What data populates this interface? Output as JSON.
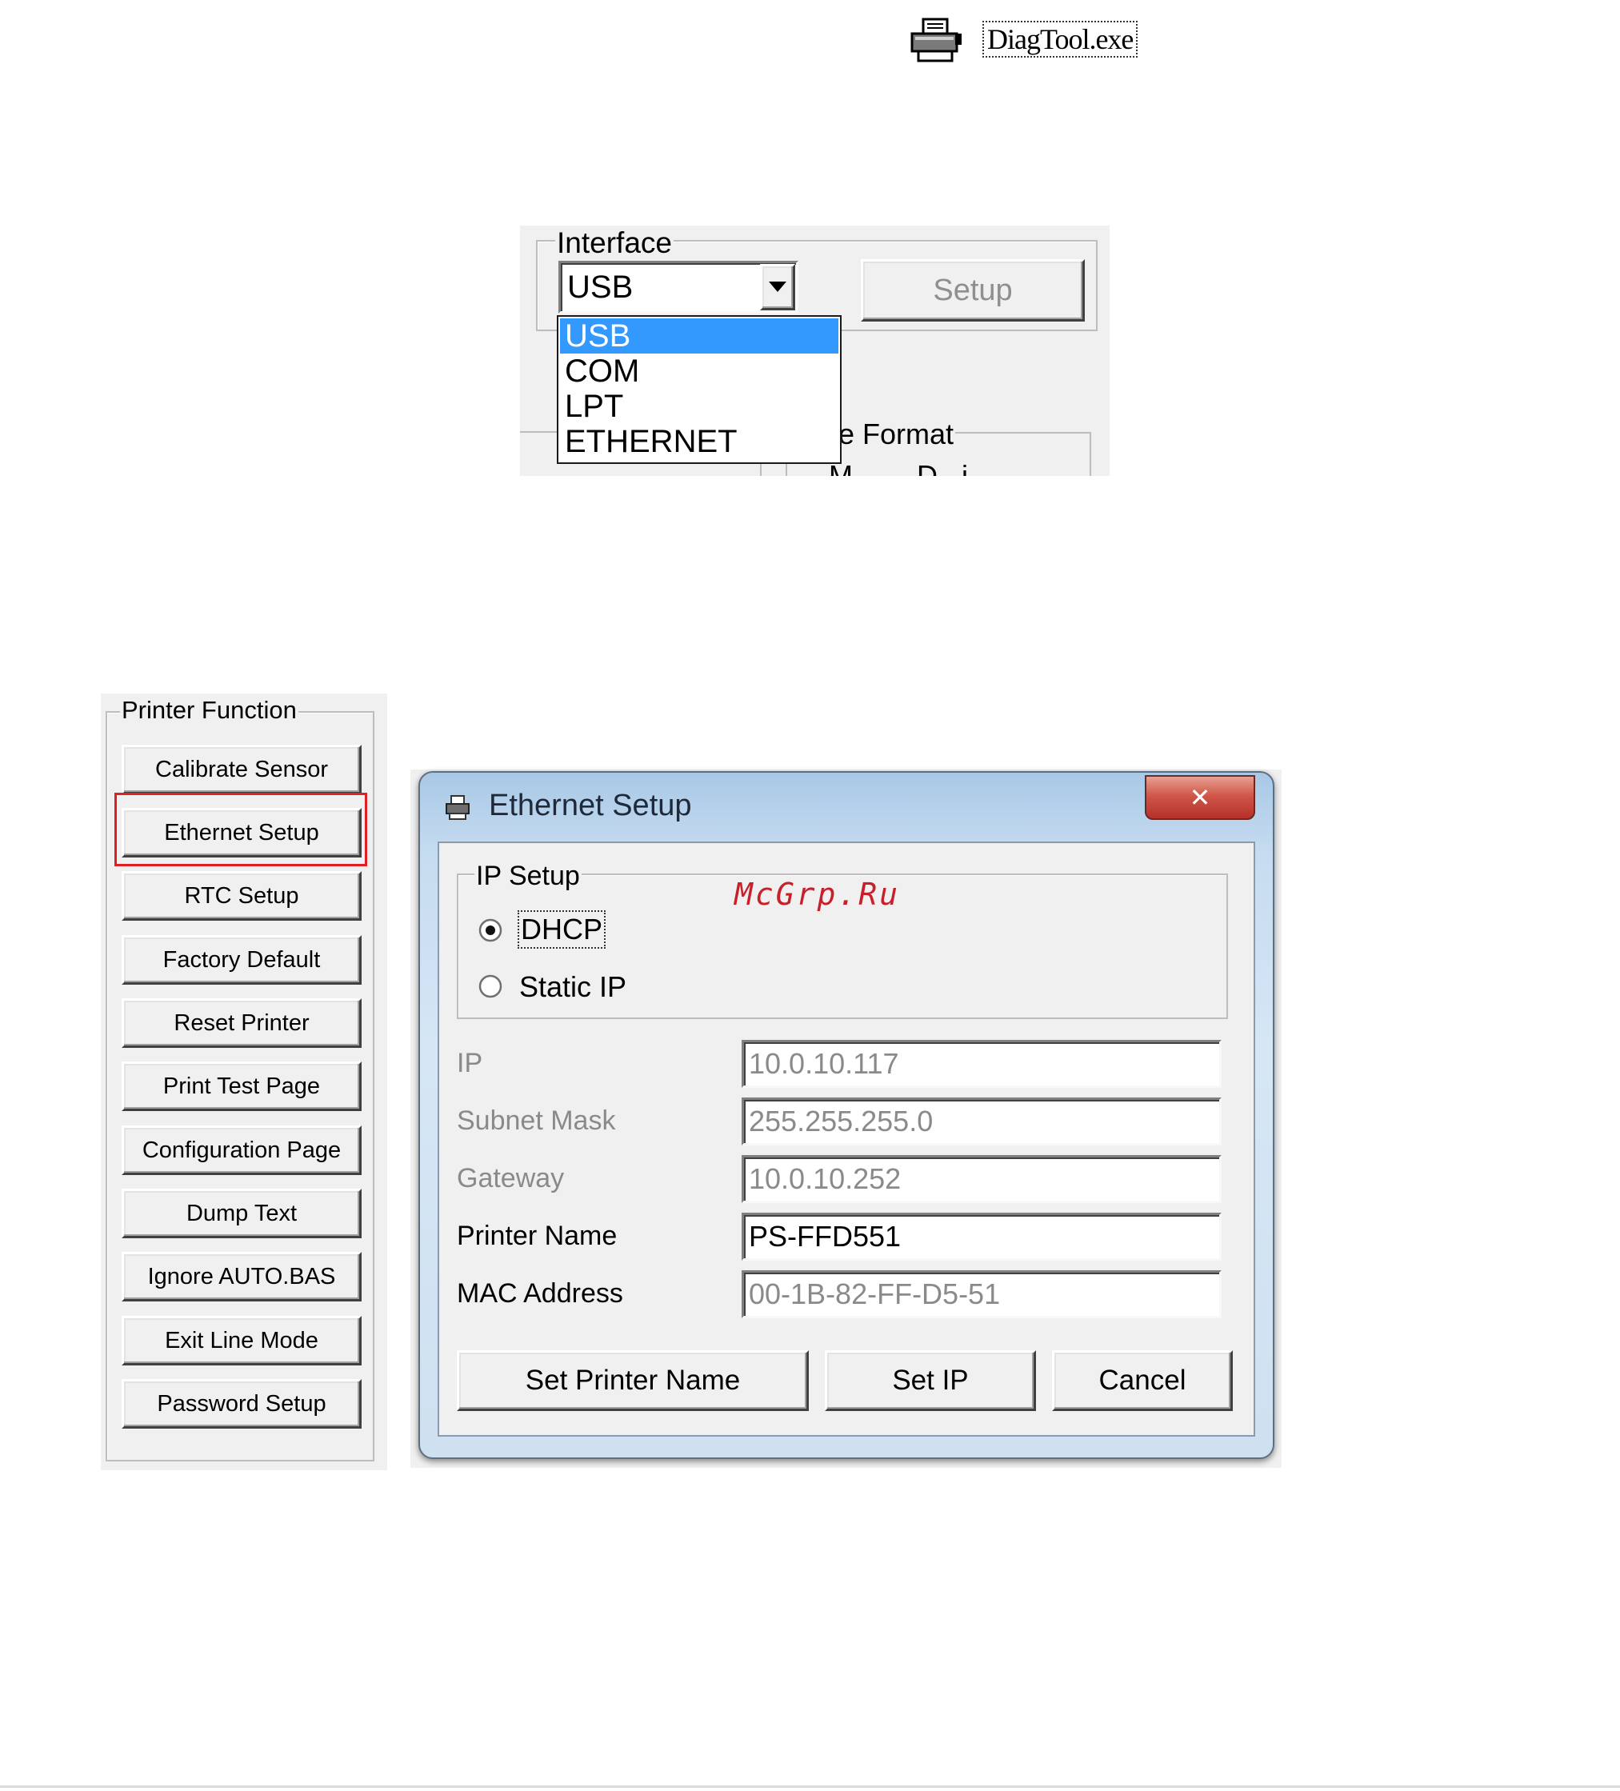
{
  "file_icon": {
    "icon": "printer-icon",
    "filename": "DiagTool.exe"
  },
  "interface": {
    "label": "Interface",
    "selected": "USB",
    "setup_label": "Setup",
    "options": [
      "USB",
      "COM",
      "LPT",
      "ETHERNET"
    ],
    "highlighted_index": 0,
    "peek_text_1": "e Format",
    "peek_text_2": "M        D   i"
  },
  "printer_function": {
    "label": "Printer Function",
    "buttons": [
      "Calibrate Sensor",
      "Ethernet Setup",
      "RTC Setup",
      "Factory Default",
      "Reset Printer",
      "Print Test Page",
      "Configuration Page",
      "Dump Text",
      "Ignore AUTO.BAS",
      "Exit Line Mode",
      "Password Setup"
    ],
    "highlight_color": "#e02020"
  },
  "ethernet_dialog": {
    "title": "Ethernet Setup",
    "close_glyph": "✕",
    "ip_setup_label": "IP Setup",
    "dhcp_label": "DHCP",
    "static_ip_label": "Static IP",
    "fields": {
      "ip": {
        "label": "IP",
        "value": "10.0.10.117"
      },
      "subnet": {
        "label": "Subnet Mask",
        "value": "255.255.255.0"
      },
      "gateway": {
        "label": "Gateway",
        "value": "10.0.10.252"
      },
      "printer_name": {
        "label": "Printer Name",
        "value": "PS-FFD551"
      },
      "mac": {
        "label": "MAC Address",
        "value": "00-1B-82-FF-D5-51"
      }
    },
    "buttons": {
      "set_printer_name": "Set Printer Name",
      "set_ip": "Set IP",
      "cancel": "Cancel"
    }
  },
  "watermark": "McGrp.Ru",
  "colors": {
    "selection": "#3399ff",
    "watermark": "#c8202a",
    "dialog_frame": "#b4cde6",
    "close_button": "#c7453a"
  }
}
